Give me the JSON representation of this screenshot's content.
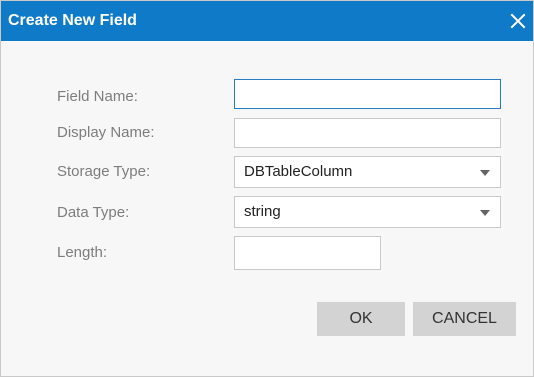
{
  "dialog": {
    "title": "Create New Field"
  },
  "form": {
    "field_name": {
      "label": "Field Name:",
      "value": ""
    },
    "display_name": {
      "label": "Display Name:",
      "value": ""
    },
    "storage_type": {
      "label": "Storage Type:",
      "value": "DBTableColumn"
    },
    "data_type": {
      "label": "Data Type:",
      "value": "string"
    },
    "length": {
      "label": "Length:",
      "value": ""
    }
  },
  "buttons": {
    "ok": "OK",
    "cancel": "CANCEL"
  },
  "icons": {
    "close": "close-icon",
    "dropdown": "chevron-down-icon"
  },
  "colors": {
    "titlebar": "#0f7ac7",
    "focus_border": "#2b7bc1",
    "button_bg": "#d3d3d3"
  }
}
